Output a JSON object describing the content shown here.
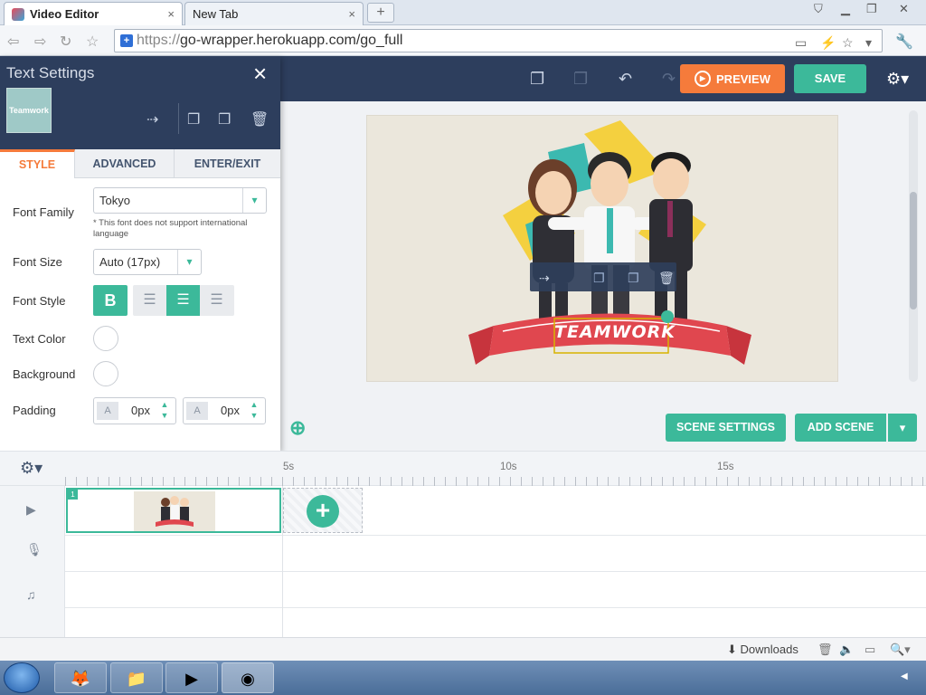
{
  "browser": {
    "tabs": [
      {
        "label": "Video Editor",
        "close": "×"
      },
      {
        "label": "New Tab",
        "close": "×"
      }
    ],
    "new_tab": "+",
    "url_scheme": "https://",
    "url_rest": "go-wrapper.herokuapp.com/go_full"
  },
  "appbar": {
    "preview_label": "PREVIEW",
    "save_label": "SAVE"
  },
  "panel": {
    "title": "Text Settings",
    "close": "×",
    "thumbnail_text": "Teamwork",
    "tabs": [
      "STYLE",
      "ADVANCED",
      "ENTER/EXIT"
    ],
    "active_tab": "STYLE",
    "font_family_label": "Font Family",
    "font_family_value": "Tokyo",
    "font_note": "* This font does not support international language",
    "font_size_label": "Font Size",
    "font_size_value": "Auto (17px)",
    "font_style_label": "Font Style",
    "bold_label": "B",
    "text_color_label": "Text Color",
    "background_label": "Background",
    "padding_label": "Padding",
    "padding_left_value": "0px",
    "padding_top_value": "0px"
  },
  "scene": {
    "banner_text": "TEAMWORK"
  },
  "canvas_actions": {
    "scene_settings": "SCENE SETTINGS",
    "add_scene": "ADD SCENE"
  },
  "timeline": {
    "ticks": [
      "5s",
      "10s",
      "15s"
    ],
    "clip_number": "1",
    "clip_thumb_text": "Teamwork"
  },
  "status": {
    "downloads": "Downloads"
  },
  "colors": {
    "navy": "#2d3e5d",
    "green": "#3cb99a",
    "orange": "#f57b3b",
    "banner_red": "#e0474f"
  }
}
